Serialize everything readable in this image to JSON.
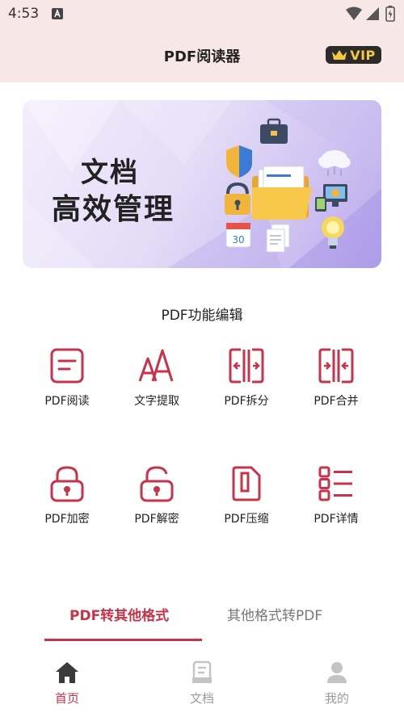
{
  "status_bar": {
    "time": "4:53",
    "icons": [
      "a-notification-icon",
      "wifi-icon",
      "signal-icon",
      "battery-icon"
    ]
  },
  "header": {
    "title": "PDF阅读器",
    "vip_label": "VIP"
  },
  "banner": {
    "line1": "文档",
    "line2": "高效管理"
  },
  "section": {
    "title": "PDF功能编辑"
  },
  "features": [
    {
      "label": "PDF阅读",
      "icon": "reader-icon"
    },
    {
      "label": "文字提取",
      "icon": "text-extract-icon"
    },
    {
      "label": "PDF拆分",
      "icon": "split-icon"
    },
    {
      "label": "PDF合并",
      "icon": "merge-icon"
    },
    {
      "label": "PDF加密",
      "icon": "lock-icon"
    },
    {
      "label": "PDF解密",
      "icon": "unlock-icon"
    },
    {
      "label": "PDF压缩",
      "icon": "compress-icon"
    },
    {
      "label": "PDF详情",
      "icon": "details-icon"
    }
  ],
  "tabs": [
    {
      "label": "PDF转其他格式",
      "active": true
    },
    {
      "label": "其他格式转PDF",
      "active": false
    }
  ],
  "bottom_nav": [
    {
      "label": "首页",
      "icon": "home-icon",
      "active": true
    },
    {
      "label": "文档",
      "icon": "document-icon",
      "active": false
    },
    {
      "label": "我的",
      "icon": "profile-icon",
      "active": false
    }
  ],
  "colors": {
    "accent": "#c8334a",
    "header_bg": "#f8e7e7",
    "vip_gold": "#f5c842",
    "inactive": "#9a9a9a"
  }
}
